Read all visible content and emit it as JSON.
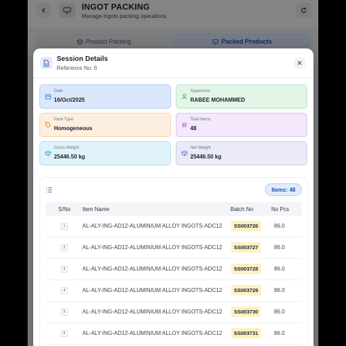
{
  "app": {
    "title": "INGOT PACKING",
    "subtitle": "Manage Ingots packing operations",
    "icons": {
      "back": "chevron-left-icon",
      "app": "monitor-icon",
      "refresh": "refresh-icon"
    }
  },
  "tabs": [
    {
      "label": "Product Packing",
      "icon": "box-icon",
      "active": false
    },
    {
      "label": "Packed Products",
      "icon": "monitor-icon",
      "active": true
    }
  ],
  "modal": {
    "title": "Session Details",
    "reference": "Reference No: 6",
    "cards": {
      "date": {
        "label": "Date",
        "value": "16/Oct/2025",
        "icon": "calendar-icon"
      },
      "supervisor": {
        "label": "Supervisor",
        "value": "RABEE MOHAMMED",
        "icon": "user-icon"
      },
      "pack_type": {
        "label": "Pack Type",
        "value": "Homogeneous",
        "icon": "tag-icon"
      },
      "total_items": {
        "label": "Total Items",
        "value": "48",
        "icon": "hash-icon"
      },
      "gross_weight": {
        "label": "Gross Weight",
        "value": "25446.50 kg",
        "icon": "box-icon"
      },
      "net_weight": {
        "label": "Net Weight",
        "value": "25446.50 kg",
        "icon": "box-icon"
      }
    },
    "table": {
      "badge": "Items: 48",
      "headers": {
        "sno": "S/No",
        "item": "Item Name",
        "batch": "Batch No",
        "pcs": "No Pcs"
      },
      "rows": [
        {
          "sno": "1",
          "item": "AL-ALY-ING-AD12-ALUMINIUM ALLOY INGOTS-ADC12",
          "batch": "SS003726",
          "pcs": "86.0"
        },
        {
          "sno": "2",
          "item": "AL-ALY-ING-AD12-ALUMINIUM ALLOY INGOTS-ADC12",
          "batch": "SS003727",
          "pcs": "86.0"
        },
        {
          "sno": "3",
          "item": "AL-ALY-ING-AD12-ALUMINIUM ALLOY INGOTS-ADC12",
          "batch": "SS003728",
          "pcs": "86.0"
        },
        {
          "sno": "4",
          "item": "AL-ALY-ING-AD12-ALUMINIUM ALLOY INGOTS-ADC12",
          "batch": "SS003729",
          "pcs": "86.0"
        },
        {
          "sno": "5",
          "item": "AL-ALY-ING-AD12-ALUMINIUM ALLOY INGOTS-ADC12",
          "batch": "SS003730",
          "pcs": "86.0"
        },
        {
          "sno": "6",
          "item": "AL-ALY-ING-AD12-ALUMINIUM ALLOY INGOTS-ADC12",
          "batch": "SS003731",
          "pcs": "86.0"
        }
      ]
    }
  },
  "colors": {
    "accent": "#1d4fb8",
    "batch_highlight": "#fdf1c4",
    "overlay": "#000000"
  }
}
